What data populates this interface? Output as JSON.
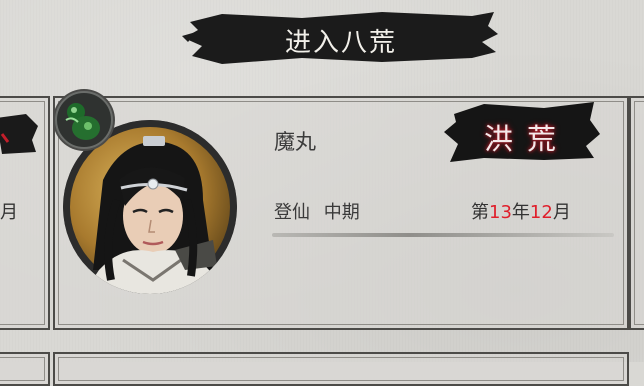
{
  "header": {
    "title": "进入八荒"
  },
  "left_card": {
    "month_fragment": "月"
  },
  "character": {
    "name": "魔丸",
    "realm": "登仙  中期",
    "portrait_icon": "cultivator-portrait",
    "badge_icon": "jade-gourd-icon"
  },
  "world": {
    "seal_label": "洪荒",
    "date": {
      "prefix": "第",
      "year": "13",
      "year_unit": "年",
      "month": "12",
      "month_unit": "月"
    }
  },
  "colors": {
    "background": "#d9d8d4",
    "ink": "#1a1a1a",
    "date_highlight": "#e01f2b",
    "seal_glow": "#c81e2c"
  }
}
